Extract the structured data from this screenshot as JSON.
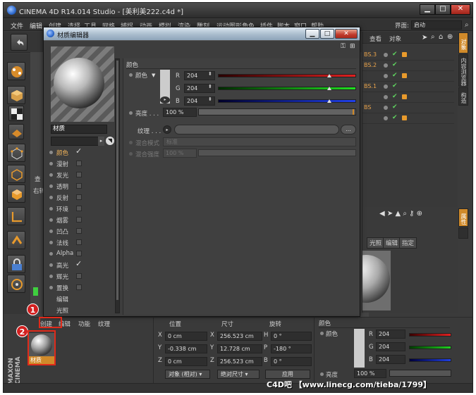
{
  "window": {
    "title": "CINEMA 4D R14.014 Studio - [美利美222.c4d *]",
    "minimize": "▁",
    "maximize": "□",
    "close": "✕"
  },
  "menu": {
    "items": [
      "文件",
      "编辑",
      "创建",
      "选择",
      "工具",
      "网格",
      "捕捉",
      "动画",
      "模拟",
      "渲染",
      "雕刻",
      "运动图形",
      "角色",
      "插件",
      "脚本",
      "窗口",
      "帮助"
    ],
    "layout_label": "界面:",
    "layout_value": "启动"
  },
  "object_manager": {
    "tabs": [
      "查看",
      "对象"
    ],
    "rows": [
      "BS.3",
      "BS.2",
      "",
      "BS.1",
      "",
      "BS",
      ""
    ]
  },
  "side_tabs": [
    "对象",
    "内容浏览器",
    "构造"
  ],
  "side_tab_attr": "属性",
  "material_editor": {
    "title": "材质编辑器",
    "material_name": "材质",
    "channels": [
      {
        "label": "颜色",
        "checked": true,
        "active": true
      },
      {
        "label": "漫射",
        "checked": false
      },
      {
        "label": "发光",
        "checked": false
      },
      {
        "label": "透明",
        "checked": false
      },
      {
        "label": "反射",
        "checked": false
      },
      {
        "label": "环境",
        "checked": false
      },
      {
        "label": "烟雾",
        "checked": false
      },
      {
        "label": "凹凸",
        "checked": false
      },
      {
        "label": "法线",
        "checked": false
      },
      {
        "label": "Alpha",
        "checked": false
      },
      {
        "label": "高光",
        "checked": true
      },
      {
        "label": "辉光",
        "checked": false
      },
      {
        "label": "置换",
        "checked": false
      },
      {
        "label": "编辑",
        "checked": null
      },
      {
        "label": "光照",
        "checked": null
      }
    ],
    "section_title": "颜色",
    "color_label": "颜色",
    "r_label": "R",
    "g_label": "G",
    "b_label": "B",
    "r_value": "204",
    "g_value": "204",
    "b_value": "204",
    "brightness_label": "亮度 . . .",
    "brightness_value": "100 %",
    "texture_label": "纹理 . . .",
    "texture_btn": "...",
    "mix_mode_label": "混合模式",
    "mix_mode_value": "标准",
    "mix_strength_label": "混合强度",
    "mix_strength_value": "100 %",
    "swatch_color": "#cccccc",
    "r_fraction": 0.8,
    "g_fraction": 0.8,
    "b_fraction": 0.8,
    "brightness_fraction": 1.0
  },
  "left_panel": {
    "label_a": "查",
    "label_b": "右转"
  },
  "attr_panel": {
    "tabs": [
      "光照",
      "编辑",
      "指定"
    ],
    "section": "颜色",
    "color_label": "颜色",
    "r_value": "204",
    "g_value": "204",
    "b_value": "204",
    "r_label": "R",
    "g_label": "G",
    "b_label": "B",
    "brightness_label": "亮度",
    "brightness_value": "100 %"
  },
  "material_manager": {
    "tabs": [
      "创建",
      "编辑",
      "功能",
      "纹理"
    ],
    "material_label": "材质"
  },
  "coords": {
    "headers": [
      "位置",
      "尺寸",
      "旋转"
    ],
    "rows": [
      {
        "axis": "X",
        "pos": "0 cm",
        "size_axis": "X",
        "size": "256.523 cm",
        "rot_axis": "H",
        "rot": "0 °"
      },
      {
        "axis": "Y",
        "pos": "-0.338 cm",
        "size_axis": "Y",
        "size": "12.728 cm",
        "rot_axis": "P",
        "rot": "-180 °"
      },
      {
        "axis": "Z",
        "pos": "0 cm",
        "size_axis": "Z",
        "size": "256.523 cm",
        "rot_axis": "B",
        "rot": "0 °"
      }
    ],
    "mode_dropdown": "对象 (相对)",
    "size_dropdown": "绝对尺寸",
    "apply_button": "应用"
  },
  "maxon_logo": "MAXON CINEMA",
  "annotations": [
    "1",
    "2"
  ],
  "watermark": "C4D吧 【www.linecg.com/tieba/1799】"
}
